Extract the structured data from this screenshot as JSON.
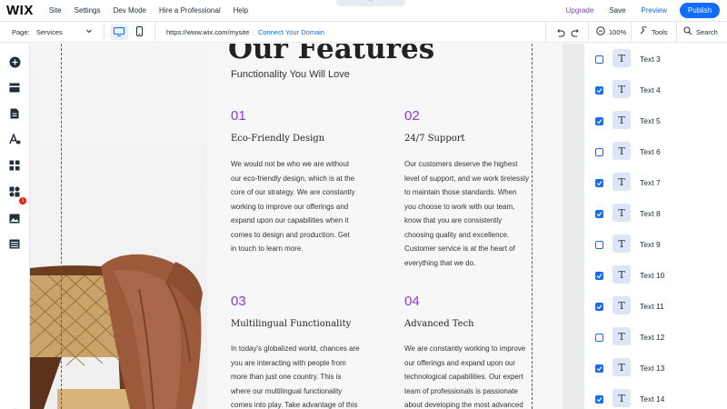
{
  "topbar": {
    "logo": "WIX",
    "menu": [
      "Site",
      "Settings",
      "Dev Mode",
      "Hire a Professional",
      "Help"
    ],
    "drawer_chevron": "⌃",
    "upgrade": "Upgrade",
    "save": "Save",
    "preview": "Preview",
    "publish": "Publish",
    "colors": {
      "accent": "#116dff",
      "upgrade": "#8b3ae6"
    }
  },
  "toolbar": {
    "page_label": "Page:",
    "page_value": "Services",
    "url": "https://www.wix.com/mysite",
    "connect_domain": "Connect Your Domain",
    "zoom": "100%",
    "tools": "Tools",
    "search": "Search"
  },
  "leftbar": {
    "icons": [
      "add-icon",
      "sections-icon",
      "pages-icon",
      "theme-icon",
      "apps-icon",
      "business-icon",
      "media-icon",
      "cms-icon"
    ],
    "apps_badge": "1"
  },
  "canvas": {
    "hero_title": "Our Features",
    "hero_subtitle": "Functionality You Will Love",
    "features": [
      {
        "num": "01",
        "title": "Eco-Friendly Design",
        "lines": [
          "We would not be who we are without",
          "our eco-friendly design, which is at the",
          "core of our strategy. We are constantly",
          "working to improve our offerings and",
          "expand upon our capabilities when it",
          "comes to design and production. Get",
          "in touch to learn more."
        ]
      },
      {
        "num": "02",
        "title": "24/7 Support",
        "lines": [
          "Our customers deserve the highest",
          "level of support, and we work tirelessly",
          "to maintain those standards. When",
          "you choose to work with our team,",
          "know that you are consistently",
          "choosing quality and excellence.",
          "Customer service is at the heart of",
          "everything that we do."
        ]
      },
      {
        "num": "03",
        "title": "Multilingual Functionality",
        "lines": [
          "In today's globalized world, chances are",
          "you are interacting with people from",
          "more than just one country. This is",
          "where our multilingual functionality",
          "comes into play. Take advantage of this"
        ]
      },
      {
        "num": "04",
        "title": "Advanced Tech",
        "lines": [
          "We are constantly working to improve",
          "our offerings and expand upon our",
          "technological capabilities. Our expert",
          "team of professionals is passionate",
          "about developing the most advanced"
        ]
      }
    ]
  },
  "layers": [
    {
      "label": "Text 3",
      "checked": false
    },
    {
      "label": "Text 4",
      "checked": true
    },
    {
      "label": "Text 5",
      "checked": true
    },
    {
      "label": "Text 6",
      "checked": false
    },
    {
      "label": "Text 7",
      "checked": true
    },
    {
      "label": "Text 8",
      "checked": true
    },
    {
      "label": "Text 9",
      "checked": false
    },
    {
      "label": "Text 10",
      "checked": true
    },
    {
      "label": "Text 11",
      "checked": true
    },
    {
      "label": "Text 12",
      "checked": false
    },
    {
      "label": "Text 13",
      "checked": true
    },
    {
      "label": "Text 14",
      "checked": true
    }
  ],
  "layer_thumb_glyph": "T"
}
